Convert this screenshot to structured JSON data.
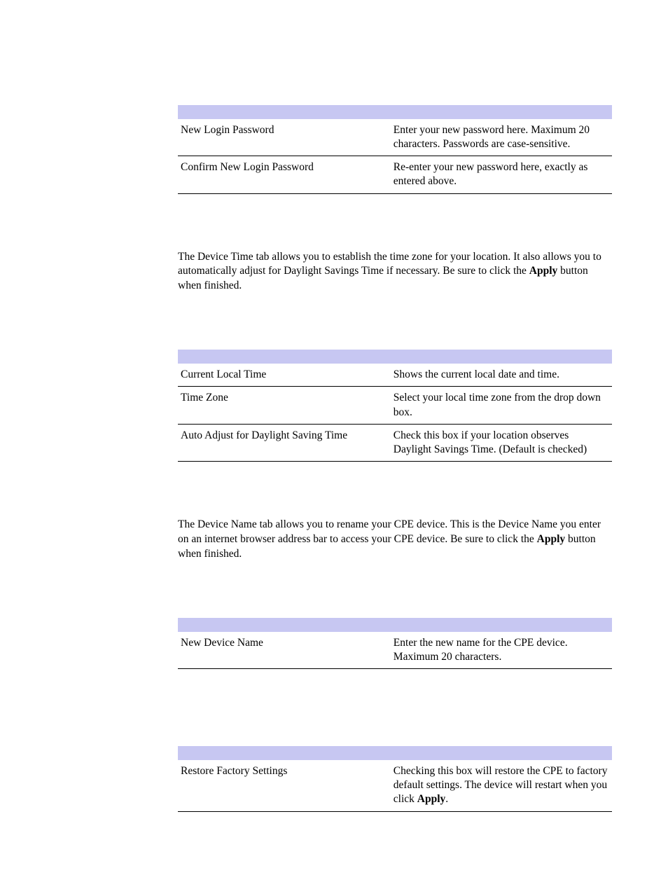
{
  "table1": {
    "rows": [
      {
        "field": "New Login Password",
        "desc": "Enter your new password here. Maximum 20 characters. Passwords are case-sensitive."
      },
      {
        "field": "Confirm New Login Password",
        "desc": "Re-enter your new password here, exactly as entered above."
      }
    ]
  },
  "para1": {
    "pre": "The Device Time tab allows you to establish the time zone for your location. It also allows you to automatically adjust for Daylight Savings Time if necessary. Be sure to click the ",
    "bold": "Apply",
    "post": " button when finished."
  },
  "table2": {
    "rows": [
      {
        "field": "Current Local Time",
        "desc": "Shows the current local date and time."
      },
      {
        "field": "Time Zone",
        "desc": "Select your local time zone from the drop down box."
      },
      {
        "field": "Auto Adjust for Daylight Saving Time",
        "desc": "Check this box if your location observes Daylight Savings Time. (Default is checked)"
      }
    ]
  },
  "para2": {
    "pre": "The Device Name tab allows you to rename your CPE device. This is the Device Name you enter on an internet browser address bar to access your CPE device. Be sure to click the ",
    "bold": "Apply",
    "post": " button when finished."
  },
  "table3": {
    "rows": [
      {
        "field": "New Device Name",
        "desc": "Enter the new name for the CPE device. Maximum 20 characters."
      }
    ]
  },
  "table4": {
    "rows": [
      {
        "field": "Restore Factory Settings",
        "desc_pre": "Checking this box will restore the CPE to factory default settings. The device will restart when you click ",
        "desc_bold": "Apply",
        "desc_post": "."
      }
    ]
  }
}
